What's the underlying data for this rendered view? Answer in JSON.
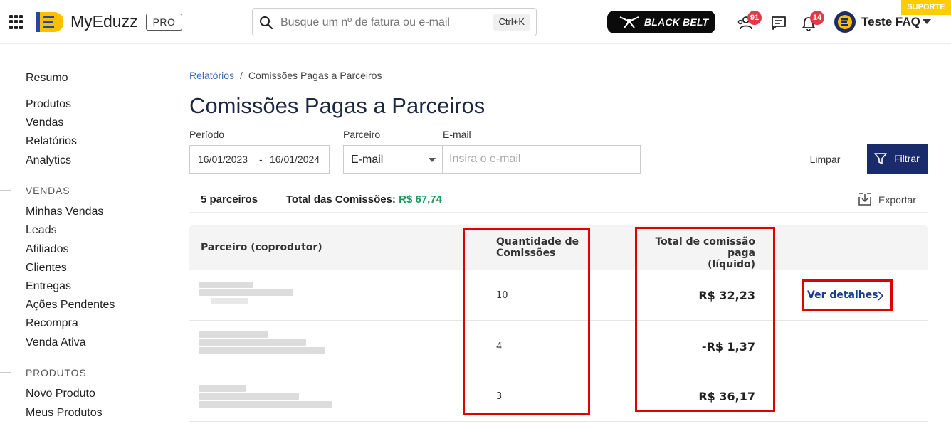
{
  "header": {
    "brand": "MyEduzz",
    "plan_badge": "PRO",
    "search": {
      "placeholder": "Busque um nº de fatura ou e-mail",
      "shortcut": "Ctrl+K"
    },
    "black_belt": "BLACK BELT",
    "notifications": {
      "community_count": "91",
      "bell_count": "14"
    },
    "user_name": "Teste FAQ",
    "support_label": "SUPORTE"
  },
  "sidebar": {
    "top_items": [
      "Resumo"
    ],
    "main_items": [
      "Produtos",
      "Vendas",
      "Relatórios",
      "Analytics"
    ],
    "sections": [
      {
        "title": "VENDAS",
        "items": [
          "Minhas Vendas",
          "Leads",
          "Afiliados",
          "Clientes",
          "Entregas",
          "Ações Pendentes",
          "Recompra",
          "Venda Ativa"
        ]
      },
      {
        "title": "PRODUTOS",
        "items": [
          "Novo Produto",
          "Meus Produtos"
        ]
      }
    ]
  },
  "breadcrumb": {
    "parent": "Relatórios",
    "separator": "/",
    "current": "Comissões Pagas a Parceiros"
  },
  "page_title": "Comissões Pagas a Parceiros",
  "filters": {
    "period_label": "Período",
    "date_start": "16/01/2023",
    "date_sep": "-",
    "date_end": "16/01/2024",
    "partner_label": "Parceiro",
    "partner_select": "E-mail",
    "email_label": "E-mail",
    "email_placeholder": "Insira o e-mail",
    "clear_label": "Limpar",
    "filter_label": "Filtrar"
  },
  "summary": {
    "partners_count": "5 parceiros",
    "total_label": "Total das Comissões:",
    "total_value": "R$ 67,74",
    "export_label": "Exportar"
  },
  "table": {
    "headers": {
      "partner": "Parceiro (coprodutor)",
      "qty_line1": "Quantidade de",
      "qty_line2": "Comissões",
      "total_line1": "Total de comissão paga",
      "total_line2": "(líquido)"
    },
    "rows": [
      {
        "quantity": "10",
        "total": "R$ 32,23",
        "details_label": "Ver detalhes"
      },
      {
        "quantity": "4",
        "total": "-R$ 1,37"
      },
      {
        "quantity": "3",
        "total": "R$ 36,17"
      }
    ]
  },
  "colors": {
    "accent": "#1a2b6b",
    "positive": "#1a9a5a",
    "badge": "#e23b47",
    "highlight": "#e10000",
    "support": "#ffcc00"
  }
}
